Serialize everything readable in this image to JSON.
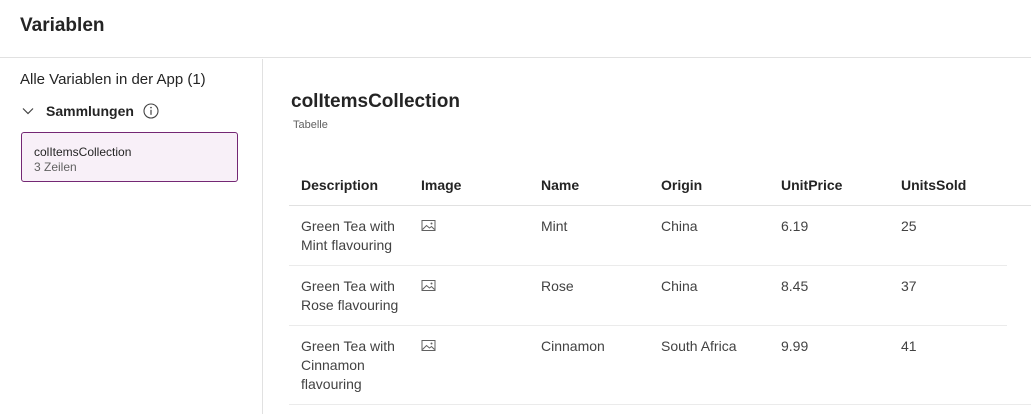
{
  "header": {
    "title": "Variablen"
  },
  "sidebar": {
    "heading": "Alle Variablen in der App (1)",
    "group_label": "Sammlungen",
    "collections": [
      {
        "name": "colItemsCollection",
        "rows_label": "3 Zeilen"
      }
    ]
  },
  "main": {
    "title": "colItemsCollection",
    "type_label": "Tabelle",
    "columns": [
      "Description",
      "Image",
      "Name",
      "Origin",
      "UnitPrice",
      "UnitsSold"
    ],
    "rows": [
      {
        "description_lines": [
          "Green Tea with",
          "Mint flavouring"
        ],
        "image": "image-icon",
        "name": "Mint",
        "origin": "China",
        "unit_price": "6.19",
        "units_sold": "25"
      },
      {
        "description_lines": [
          "Green Tea with",
          "Rose flavouring"
        ],
        "image": "image-icon",
        "name": "Rose",
        "origin": "China",
        "unit_price": "8.45",
        "units_sold": "37"
      },
      {
        "description_lines": [
          "Green Tea with",
          "Cinnamon",
          "flavouring"
        ],
        "image": "image-icon",
        "name": "Cinnamon",
        "origin": "South Africa",
        "unit_price": "9.99",
        "units_sold": "41"
      }
    ]
  },
  "colors": {
    "accent": "#742774",
    "selected_bg": "#f8f0f8"
  }
}
